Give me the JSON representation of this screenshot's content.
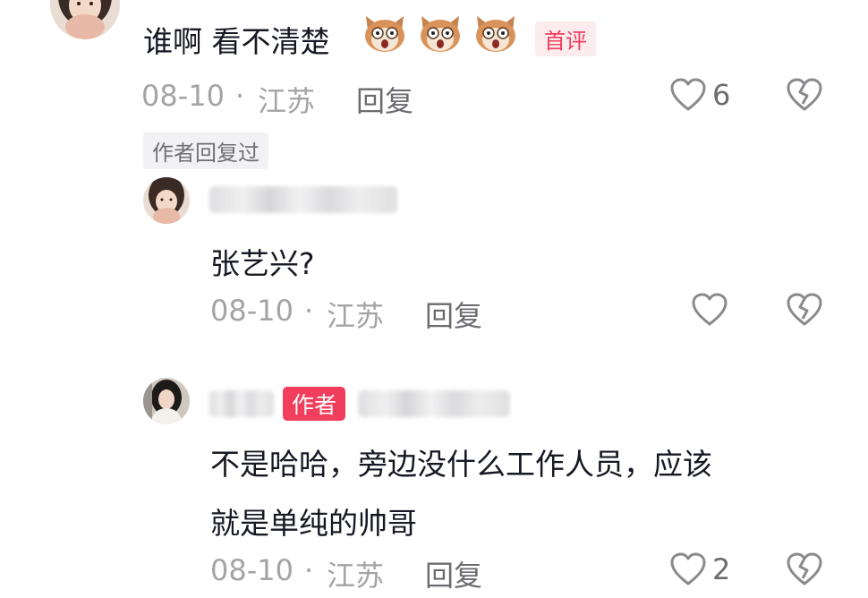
{
  "comment": {
    "text": "谁啊 看不清楚",
    "emojis": [
      "surprised-cat-emoji",
      "surprised-cat-emoji",
      "surprised-cat-emoji"
    ],
    "badge": "首评",
    "date": "08-10",
    "separator": "·",
    "location": "江苏",
    "reply_label": "回复",
    "like_count": "6",
    "author_replied_tag": "作者回复过"
  },
  "replies": [
    {
      "text": "张艺兴?",
      "date": "08-10",
      "separator": "·",
      "location": "江苏",
      "reply_label": "回复",
      "like_count": ""
    },
    {
      "author_badge": "作者",
      "text_line1": "不是哈哈，旁边没什么工作人员，应该",
      "text_line2": "就是单纯的帅哥",
      "date": "08-10",
      "separator": "·",
      "location": "江苏",
      "reply_label": "回复",
      "like_count": "2"
    }
  ],
  "colors": {
    "text": "#161823",
    "meta": "#a4a4a8",
    "accent": "#f03e5c",
    "icon": "#8a8a8e"
  }
}
